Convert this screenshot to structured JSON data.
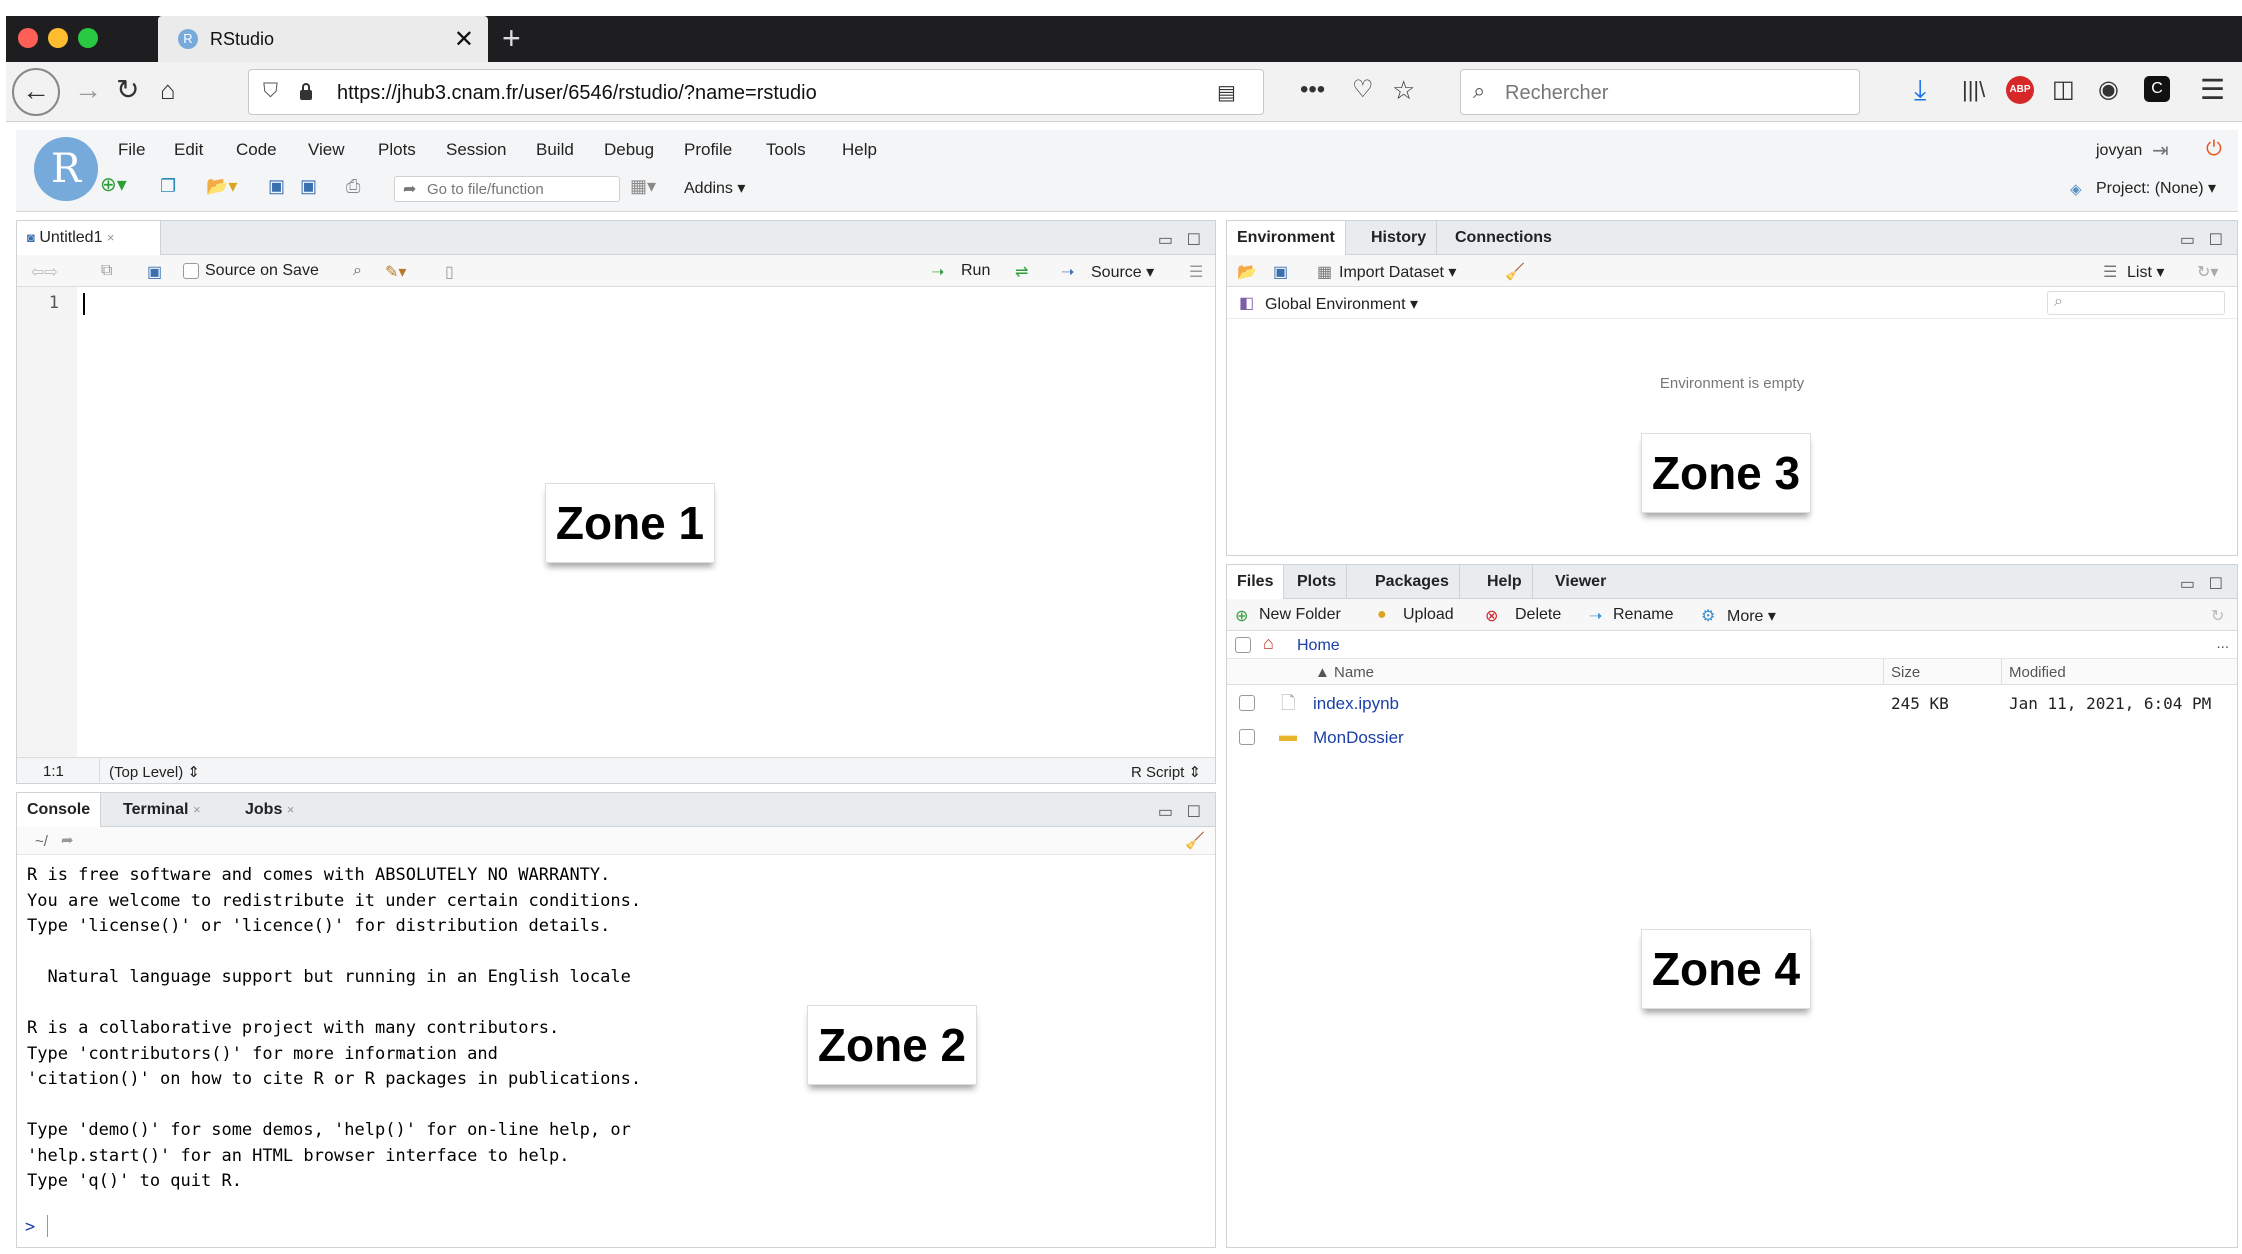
{
  "browser": {
    "tab_title": "RStudio",
    "tab_favicon": "R",
    "tab_close": "✕",
    "new_tab": "+",
    "url": "https://jhub3.cnam.fr/user/6546/rstudio/?name=rstudio",
    "search_placeholder": "Rechercher"
  },
  "rstudio": {
    "logo": "R",
    "menu": [
      "File",
      "Edit",
      "Code",
      "View",
      "Plots",
      "Session",
      "Build",
      "Debug",
      "Profile",
      "Tools",
      "Help"
    ],
    "goto_placeholder": "Go to file/function",
    "addins": "Addins",
    "user": "jovyan",
    "project": "Project: (None)"
  },
  "source_pane": {
    "tab": "Untitled1",
    "source_on_save": "Source on Save",
    "run": "Run",
    "source": "Source",
    "line_number": "1",
    "cursor_pos": "1:1",
    "scope": "(Top Level)",
    "file_type": "R Script"
  },
  "console_pane": {
    "tabs": [
      "Console",
      "Terminal",
      "Jobs"
    ],
    "path": "~/",
    "lines": [
      "R is free software and comes with ABSOLUTELY NO WARRANTY.",
      "You are welcome to redistribute it under certain conditions.",
      "Type 'license()' or 'licence()' for distribution details.",
      "",
      "  Natural language support but running in an English locale",
      "",
      "R is a collaborative project with many contributors.",
      "Type 'contributors()' for more information and",
      "'citation()' on how to cite R or R packages in publications.",
      "",
      "Type 'demo()' for some demos, 'help()' for on-line help, or",
      "'help.start()' for an HTML browser interface to help.",
      "Type 'q()' to quit R."
    ],
    "prompt": ">"
  },
  "env_pane": {
    "tabs": [
      "Environment",
      "History",
      "Connections"
    ],
    "import_dataset": "Import Dataset",
    "list_view": "List",
    "scope": "Global Environment",
    "empty_message": "Environment is empty"
  },
  "files_pane": {
    "tabs": [
      "Files",
      "Plots",
      "Packages",
      "Help",
      "Viewer"
    ],
    "actions": {
      "new_folder": "New Folder",
      "upload": "Upload",
      "delete": "Delete",
      "rename": "Rename",
      "more": "More"
    },
    "breadcrumb": "Home",
    "ellipsis": "...",
    "columns": {
      "name": "Name",
      "size": "Size",
      "modified": "Modified"
    },
    "rows": [
      {
        "name": "index.ipynb",
        "size": "245 KB",
        "modified": "Jan 11, 2021, 6:04 PM",
        "type": "file"
      },
      {
        "name": "MonDossier",
        "size": "",
        "modified": "",
        "type": "folder"
      }
    ]
  },
  "zones": {
    "zone1": "Zone 1",
    "zone2": "Zone 2",
    "zone3": "Zone 3",
    "zone4": "Zone 4"
  },
  "colors": {
    "r_blue": "#75aadb",
    "link_blue": "#1a3fa8",
    "run_green": "#2e9e3a",
    "titlebar": "#1e1e20"
  }
}
